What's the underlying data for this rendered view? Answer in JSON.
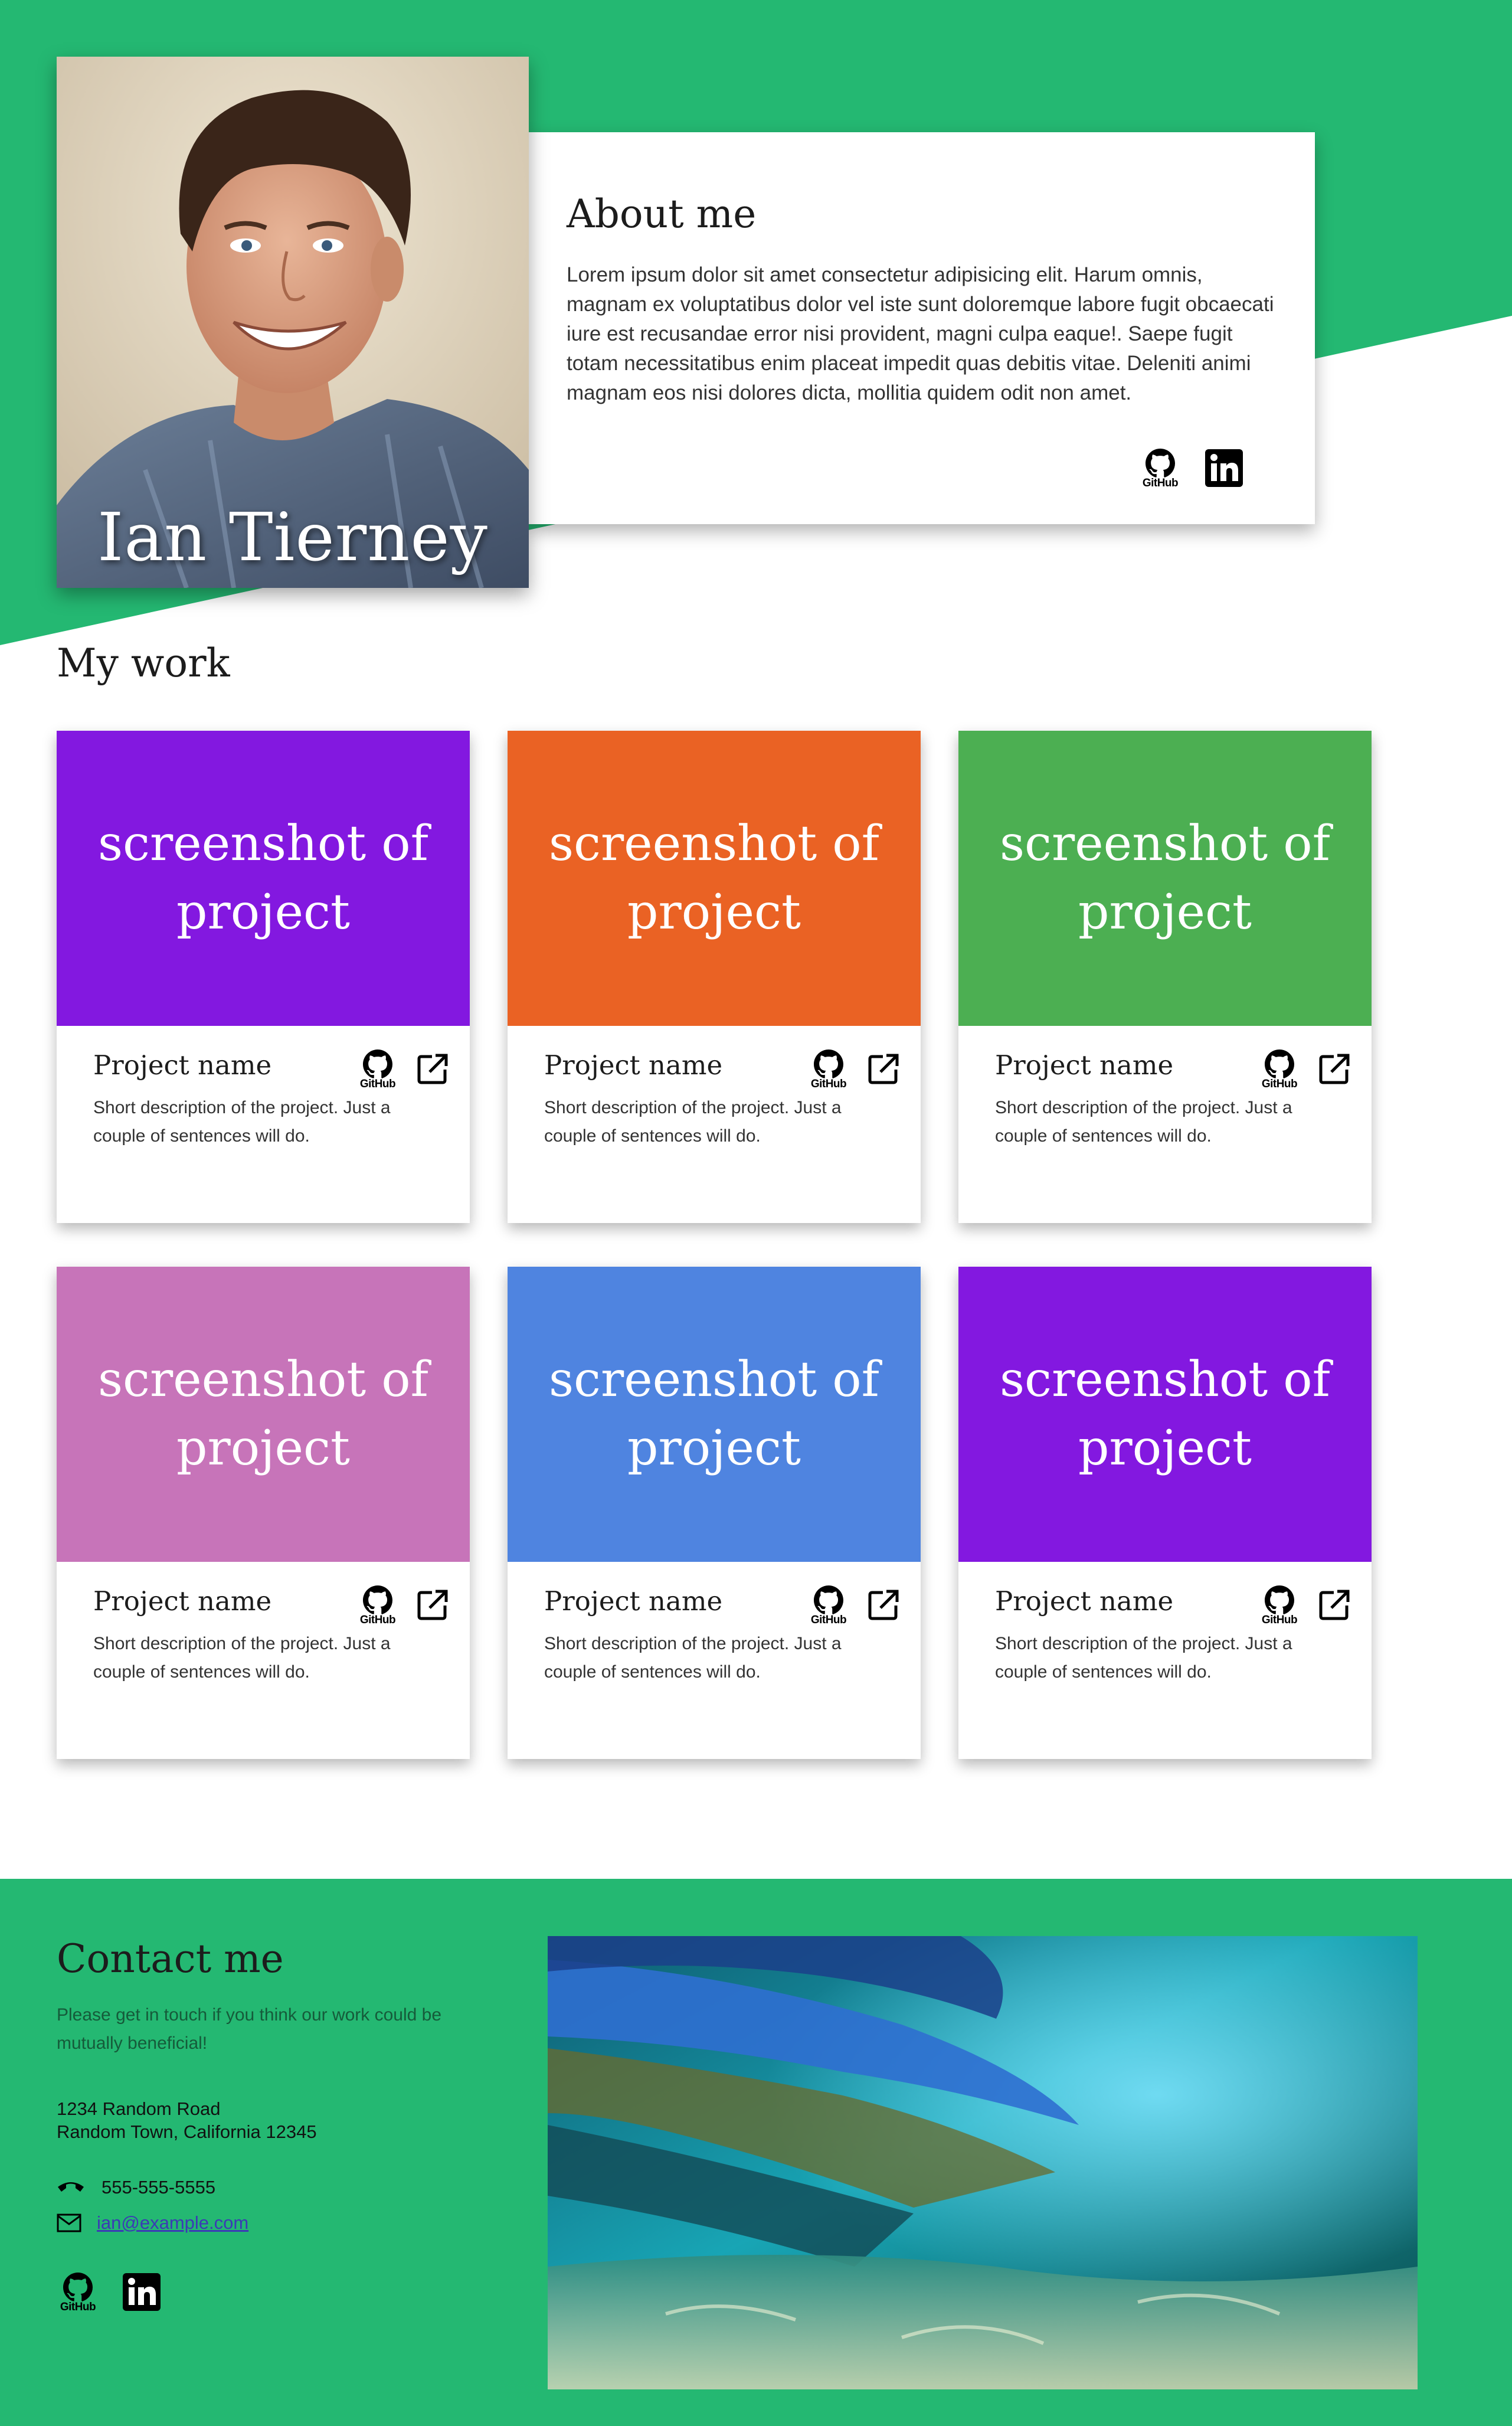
{
  "hero": {
    "name": "Ian Tierney",
    "accent_color": "#24b872"
  },
  "about": {
    "title": "About me",
    "text": "Lorem ipsum dolor sit amet consectetur adipisicing elit. Harum omnis, magnam ex voluptatibus dolor vel iste sunt doloremque labore fugit obcaecati iure est recusandae error nisi provident, magni culpa eaque!. Saepe fugit totam necessitatibus enim placeat impedit quas debitis vitae. Deleniti animi magnam eos nisi dolores dicta, mollitia quidem odit non amet.",
    "github_label": "GitHub"
  },
  "work": {
    "title": "My work",
    "projects": [
      {
        "shot_label": "screenshot of project",
        "name": "Project name",
        "description": "Short description of the project. Just a couple of sentences will do.",
        "github_label": "GitHub",
        "color": "#8318e0"
      },
      {
        "shot_label": "screenshot of project",
        "name": "Project name",
        "description": "Short description of the project. Just a couple of sentences will do.",
        "github_label": "GitHub",
        "color": "#ea6224"
      },
      {
        "shot_label": "screenshot of project",
        "name": "Project name",
        "description": "Short description of the project. Just a couple of sentences will do.",
        "github_label": "GitHub",
        "color": "#4caf52"
      },
      {
        "shot_label": "screenshot of project",
        "name": "Project name",
        "description": "Short description of the project. Just a couple of sentences will do.",
        "github_label": "GitHub",
        "color": "#c774b9"
      },
      {
        "shot_label": "screenshot of project",
        "name": "Project name",
        "description": "Short description of the project. Just a couple of sentences will do.",
        "github_label": "GitHub",
        "color": "#4f84e0"
      },
      {
        "shot_label": "screenshot of project",
        "name": "Project name",
        "description": "Short description of the project. Just a couple of sentences will do.",
        "github_label": "GitHub",
        "color": "#8318e0"
      }
    ]
  },
  "contact": {
    "title": "Contact me",
    "intro": "Please get in touch if you think our work could be mutually beneficial!",
    "address_line1": "1234 Random Road",
    "address_line2": "Random Town, California 12345",
    "phone": "555-555-5555",
    "email": "ian@example.com",
    "github_label": "GitHub"
  },
  "icons": {
    "github": "github-icon",
    "linkedin": "linkedin-icon",
    "external": "external-link-icon",
    "phone": "phone-icon",
    "email": "email-icon"
  }
}
